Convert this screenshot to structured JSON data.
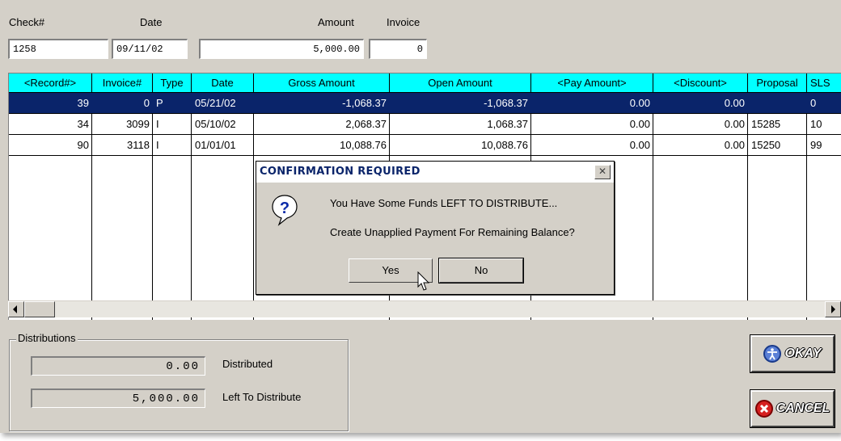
{
  "header": {
    "check_label": "Check#",
    "date_label": "Date",
    "amount_label": "Amount",
    "invoice_label": "Invoice",
    "check_value": "1258",
    "date_value": "09/11/02",
    "amount_value": "5,000.00",
    "invoice_value": "0"
  },
  "grid": {
    "columns": [
      "<Record#>",
      "Invoice#",
      "Type",
      "Date",
      "Gross Amount",
      "Open Amount",
      "<Pay Amount>",
      "<Discount>",
      "Proposal",
      "SLS"
    ],
    "rows": [
      {
        "record": "39",
        "invoice": "0",
        "type": "P",
        "date": "05/21/02",
        "gross": "-1,068.37",
        "open": "-1,068.37",
        "pay": "0.00",
        "discount": "0.00",
        "proposal": "",
        "sls": "0"
      },
      {
        "record": "34",
        "invoice": "3099",
        "type": "I",
        "date": "05/10/02",
        "gross": "2,068.37",
        "open": "1,068.37",
        "pay": "0.00",
        "discount": "0.00",
        "proposal": "15285",
        "sls": "10"
      },
      {
        "record": "90",
        "invoice": "3118",
        "type": "I",
        "date": "01/01/01",
        "gross": "10,088.76",
        "open": "10,088.76",
        "pay": "0.00",
        "discount": "0.00",
        "proposal": "15250",
        "sls": "99"
      }
    ]
  },
  "distributions": {
    "title": "Distributions",
    "distributed_value": "0.00",
    "distributed_label": "Distributed",
    "left_value": "5,000.00",
    "left_label": "Left To Distribute"
  },
  "buttons": {
    "okay": "OKAY",
    "cancel": "CANCEL"
  },
  "dialog": {
    "title": "CONFIRMATION REQUIRED",
    "message1": "You Have Some Funds LEFT TO DISTRIBUTE...",
    "message2": "Create Unapplied Payment For Remaining Balance?",
    "yes": "Yes",
    "no": "No",
    "close_glyph": "✕"
  },
  "colors": {
    "header_bg": "#00ffff",
    "selection": "#0a246a",
    "window": "#d4d0c8"
  }
}
